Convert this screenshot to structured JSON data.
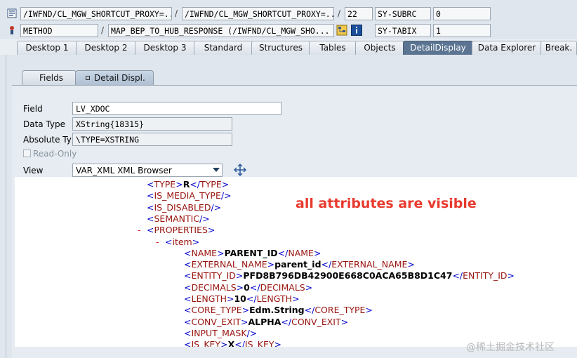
{
  "header": {
    "row1": {
      "program1": "/IWFND/CL_MGW_SHORTCUT_PROXY=...",
      "program2": "/IWFND/CL_MGW_SHORTCUT_PROXY=...",
      "line": "22",
      "sysvar": "SY-SUBRC",
      "sysval": "0"
    },
    "row2": {
      "kind": "METHOD",
      "method": "MAP_BEP_TO_HUB_RESPONSE (/IWFND/CL_MGW_SHO...",
      "sysvar": "SY-TABIX",
      "sysval": "1"
    }
  },
  "outer_tabs": [
    "Desktop 1",
    "Desktop 2",
    "Desktop 3",
    "Standard",
    "Structures",
    "Tables",
    "Objects",
    "DetailDisplay",
    "Data Explorer",
    "Break."
  ],
  "active_outer_tab": "DetailDisplay",
  "inner_tabs": [
    "Fields",
    "Detail Displ."
  ],
  "details": {
    "field_label": "Field",
    "field_value": "LV_XDOC",
    "type_label": "Data Type",
    "type_value": "XString{18315}",
    "abs_label": "Absolute Type",
    "abs_value": "\\TYPE=XSTRING",
    "readonly_label": "Read-Only",
    "view_label": "View",
    "view_value": "VAR_XML XML Browser"
  },
  "xml_lines": [
    {
      "tag": "TYPE",
      "value": "R",
      "close": true
    },
    {
      "tag": "IS_MEDIA_TYPE",
      "empty": true
    },
    {
      "tag": "IS_DISABLED",
      "empty": true
    },
    {
      "tag": "SEMANTIC",
      "empty": true
    },
    {
      "tag": "PROPERTIES",
      "open": true,
      "minus": "-"
    },
    {
      "tag": "item",
      "open": true,
      "minus": "-"
    },
    {
      "tag": "NAME",
      "value": "PARENT_ID",
      "close": true
    },
    {
      "tag": "EXTERNAL_NAME",
      "value": "parent_id",
      "close": true
    },
    {
      "tag": "ENTITY_ID",
      "value": "PFD8B796DB42900E668C0ACA65B8D1C47",
      "close": true
    },
    {
      "tag": "DECIMALS",
      "value": "0",
      "close": true
    },
    {
      "tag": "LENGTH",
      "value": "10",
      "close": true
    },
    {
      "tag": "CORE_TYPE",
      "value": "Edm.String",
      "close": true
    },
    {
      "tag": "CONV_EXIT",
      "value": "ALPHA",
      "close": true
    },
    {
      "tag": "INPUT_MASK",
      "empty": true
    },
    {
      "tag": "IS_KEY",
      "value": "X",
      "close": true
    }
  ],
  "annotation": "all attributes are visible",
  "watermark": "@稀土掘金技术社区",
  "colors": {
    "tag": "#98140f",
    "bracket": "#0000cc",
    "annotation": "#e83a2e",
    "active_tab": "#5a7492"
  }
}
